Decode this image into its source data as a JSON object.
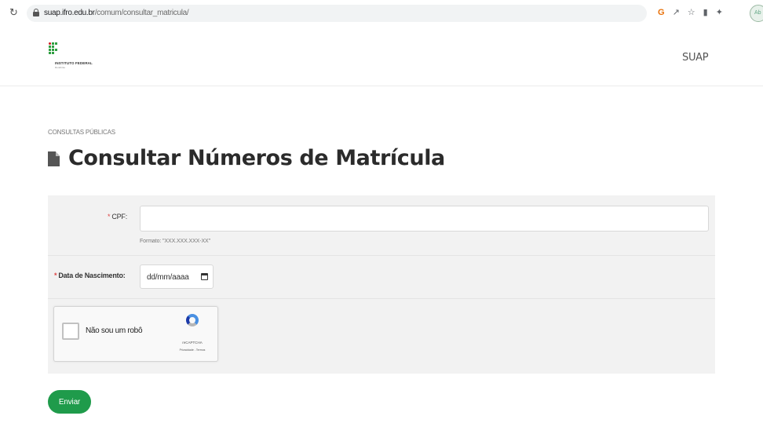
{
  "browser": {
    "url_host": "suap.ifro.edu.br",
    "url_path": "/comum/consultar_matricula/",
    "profile_label": "Ab"
  },
  "header": {
    "logo_title": "INSTITUTO FEDERAL",
    "logo_subtitle": "Rondônia",
    "nav_link": "SUAP",
    "logo_colors": {
      "green": "#2f9e41",
      "red": "#cd191e"
    }
  },
  "page": {
    "breadcrumb": "CONSULTAS PÚBLICAS",
    "title": "Consultar Números de Matrícula",
    "icon": "document-icon"
  },
  "form": {
    "cpf": {
      "required_mark": "*",
      "label": "CPF:",
      "value": "",
      "help_text": "Formato: \"XXX.XXX.XXX-XX\""
    },
    "birth_date": {
      "required_mark": "*",
      "label": "Data de Nascimento:",
      "value": "dd/mm/aaaa",
      "icon": "calendar-icon"
    },
    "captcha": {
      "label": "Não sou um robô",
      "brand": "reCAPTCHA",
      "links": "Privacidade - Termos",
      "checked": false
    },
    "submit_label": "Enviar"
  },
  "colors": {
    "accent": "#1f9b4b",
    "panel": "#f2f2f2",
    "required": "#dd4444"
  }
}
